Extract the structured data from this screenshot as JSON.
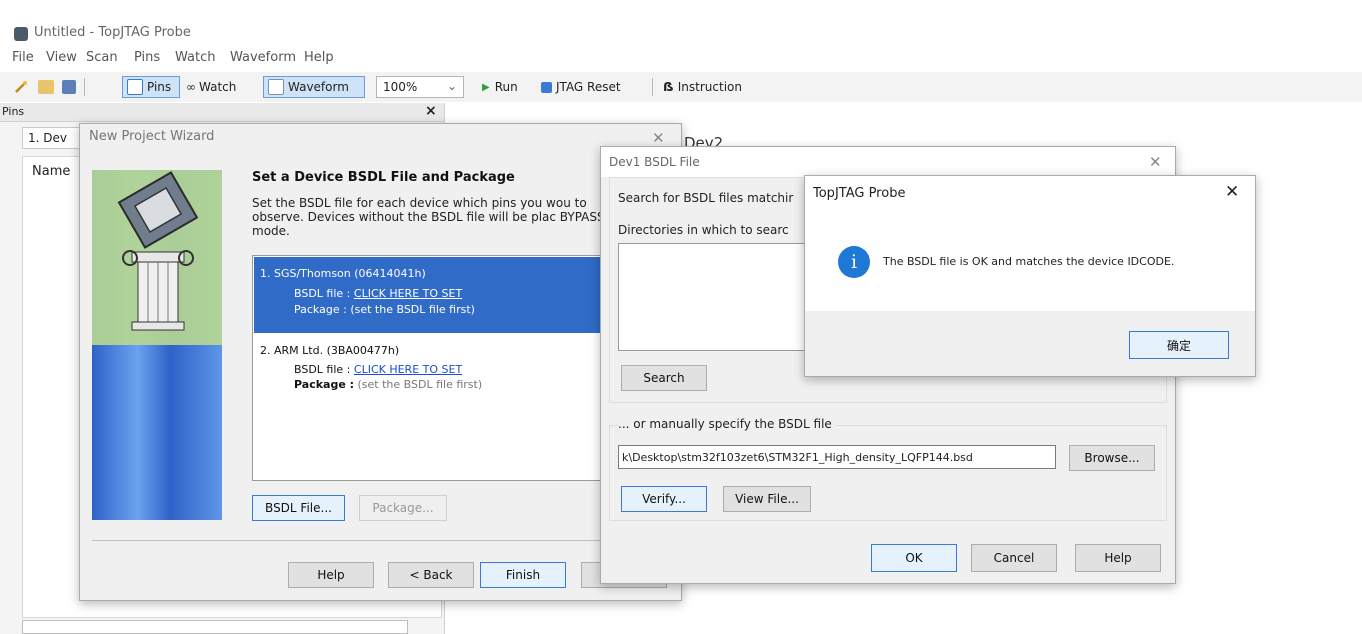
{
  "app": {
    "title": "Untitled - TopJTAG Probe"
  },
  "menu": [
    "File",
    "View",
    "Scan",
    "Pins",
    "Watch",
    "Waveform",
    "Help"
  ],
  "toolbar": {
    "pins": "Pins",
    "watch": "Watch",
    "waveform": "Waveform",
    "zoom": "100%",
    "run": "Run",
    "jtag_reset": "JTAG Reset",
    "instruction": "Instruction"
  },
  "pins_panel": {
    "title": "Pins",
    "row1": "1. Dev",
    "col_name": "Name"
  },
  "main": {
    "dev2": "Dev2"
  },
  "wizard": {
    "title": "New Project Wizard",
    "heading": "Set a Device BSDL File and Package",
    "description": "Set the BSDL file for each device which pins you wou to observe. Devices without the BSDL file will be plac BYPASS mode.",
    "devices": [
      {
        "name": "1. SGS/Thomson (06414041h)",
        "bsdl_label": "BSDL file :",
        "bsdl_link": "CLICK HERE TO SET",
        "package_label": "Package :",
        "package_value": "(set the BSDL file first)"
      },
      {
        "name": "2. ARM Ltd. (3BA00477h)",
        "bsdl_label": "BSDL file :",
        "bsdl_link": "CLICK HERE TO SET",
        "package_label": "Package :",
        "package_value": "(set the BSDL file first)"
      }
    ],
    "buttons": {
      "bsdl": "BSDL File...",
      "package": "Package...",
      "help": "Help",
      "back": "< Back",
      "finish": "Finish"
    }
  },
  "bsdl_dialog": {
    "title": "Dev1 BSDL File",
    "search_label": "Search for BSDL files matchir",
    "dirs_label": "Directories in which to searc",
    "search_button": "Search",
    "manual_label": "... or manually specify the BSDL file",
    "path_value": "k\\Desktop\\stm32f103zet6\\STM32F1_High_density_LQFP144.bsd",
    "browse": "Browse...",
    "verify": "Verify...",
    "view_file": "View File...",
    "ok": "OK",
    "cancel": "Cancel",
    "help": "Help"
  },
  "msgbox": {
    "title": "TopJTAG Probe",
    "icon": "info-icon",
    "message": "The BSDL file is OK and matches the device IDCODE.",
    "ok": "确定"
  },
  "colors": {
    "selection": "#2f6bc7",
    "accent_border": "#3c78d8",
    "info_blue": "#1e78d6",
    "wizard_side": "#3a7bd5"
  }
}
